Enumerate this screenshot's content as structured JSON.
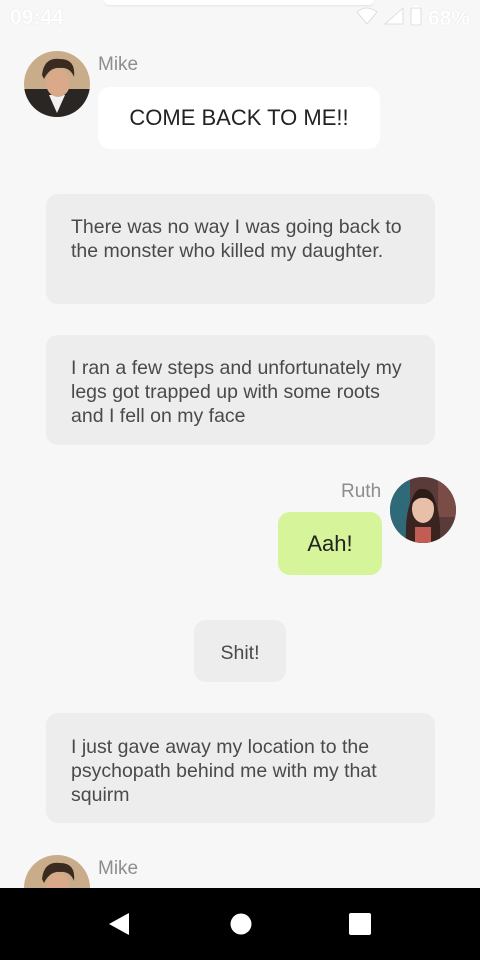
{
  "status_bar": {
    "time": "09:44",
    "battery": "68%"
  },
  "messages": [
    {
      "sender": "Mike",
      "text": "COME BACK TO ME!!"
    },
    {
      "text": "There was no way I was going back to the monster who killed my daughter."
    },
    {
      "text": "I ran a few steps and unfortunately my legs got trapped up with some roots and I fell on my face"
    },
    {
      "sender": "Ruth",
      "text": "Aah!"
    },
    {
      "text": "Shit!"
    },
    {
      "text": "I just gave away my location to the psychopath behind me with my that squirm"
    },
    {
      "sender": "Mike",
      "text": ""
    }
  ],
  "colors": {
    "background": "#f7f7f7",
    "narration_bubble": "#ededed",
    "mike_bubble": "#ffffff",
    "ruth_bubble": "#d6f499",
    "name_text": "#8d8d8d"
  },
  "icons": [
    "wifi-icon",
    "signal-icon",
    "battery-icon",
    "nav-back-icon",
    "nav-home-icon",
    "nav-recents-icon"
  ]
}
